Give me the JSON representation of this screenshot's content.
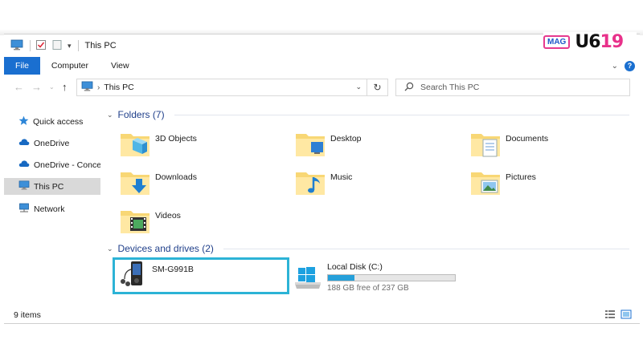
{
  "window": {
    "title": "This PC",
    "status_items": "9 items"
  },
  "ribbon": {
    "tabs": [
      {
        "label": "File"
      },
      {
        "label": "Computer"
      },
      {
        "label": "View"
      }
    ]
  },
  "address": {
    "path": "This PC",
    "search_placeholder": "Search This PC"
  },
  "nav": {
    "items": [
      {
        "label": "Quick access",
        "icon": "star-icon"
      },
      {
        "label": "OneDrive",
        "icon": "cloud-icon"
      },
      {
        "label": "OneDrive - Conce",
        "icon": "cloud-icon"
      },
      {
        "label": "This PC",
        "icon": "computer-icon",
        "selected": true
      },
      {
        "label": "Network",
        "icon": "network-icon"
      }
    ]
  },
  "folders": {
    "header": "Folders (7)",
    "items": [
      {
        "label": "3D Objects",
        "icon": "3d-objects-folder-icon"
      },
      {
        "label": "Desktop",
        "icon": "desktop-folder-icon"
      },
      {
        "label": "Documents",
        "icon": "documents-folder-icon"
      },
      {
        "label": "Downloads",
        "icon": "downloads-folder-icon"
      },
      {
        "label": "Music",
        "icon": "music-folder-icon"
      },
      {
        "label": "Pictures",
        "icon": "pictures-folder-icon"
      },
      {
        "label": "Videos",
        "icon": "videos-folder-icon"
      }
    ]
  },
  "devices": {
    "header": "Devices and drives (2)",
    "items": [
      {
        "label": "SM-G991B",
        "icon": "media-player-icon"
      },
      {
        "label": "Local Disk (C:)",
        "icon": "windows-drive-icon",
        "free_text": "188 GB free of 237 GB",
        "used_fraction": 0.207
      }
    ]
  },
  "logo": {
    "mag": "MAG",
    "num_a": "U6",
    "num_b": "19"
  },
  "colors": {
    "accent": "#1a6fd0",
    "highlight": "#2cb3d6",
    "group_header": "#1f3f8a",
    "drive_fill": "#26a0da"
  }
}
